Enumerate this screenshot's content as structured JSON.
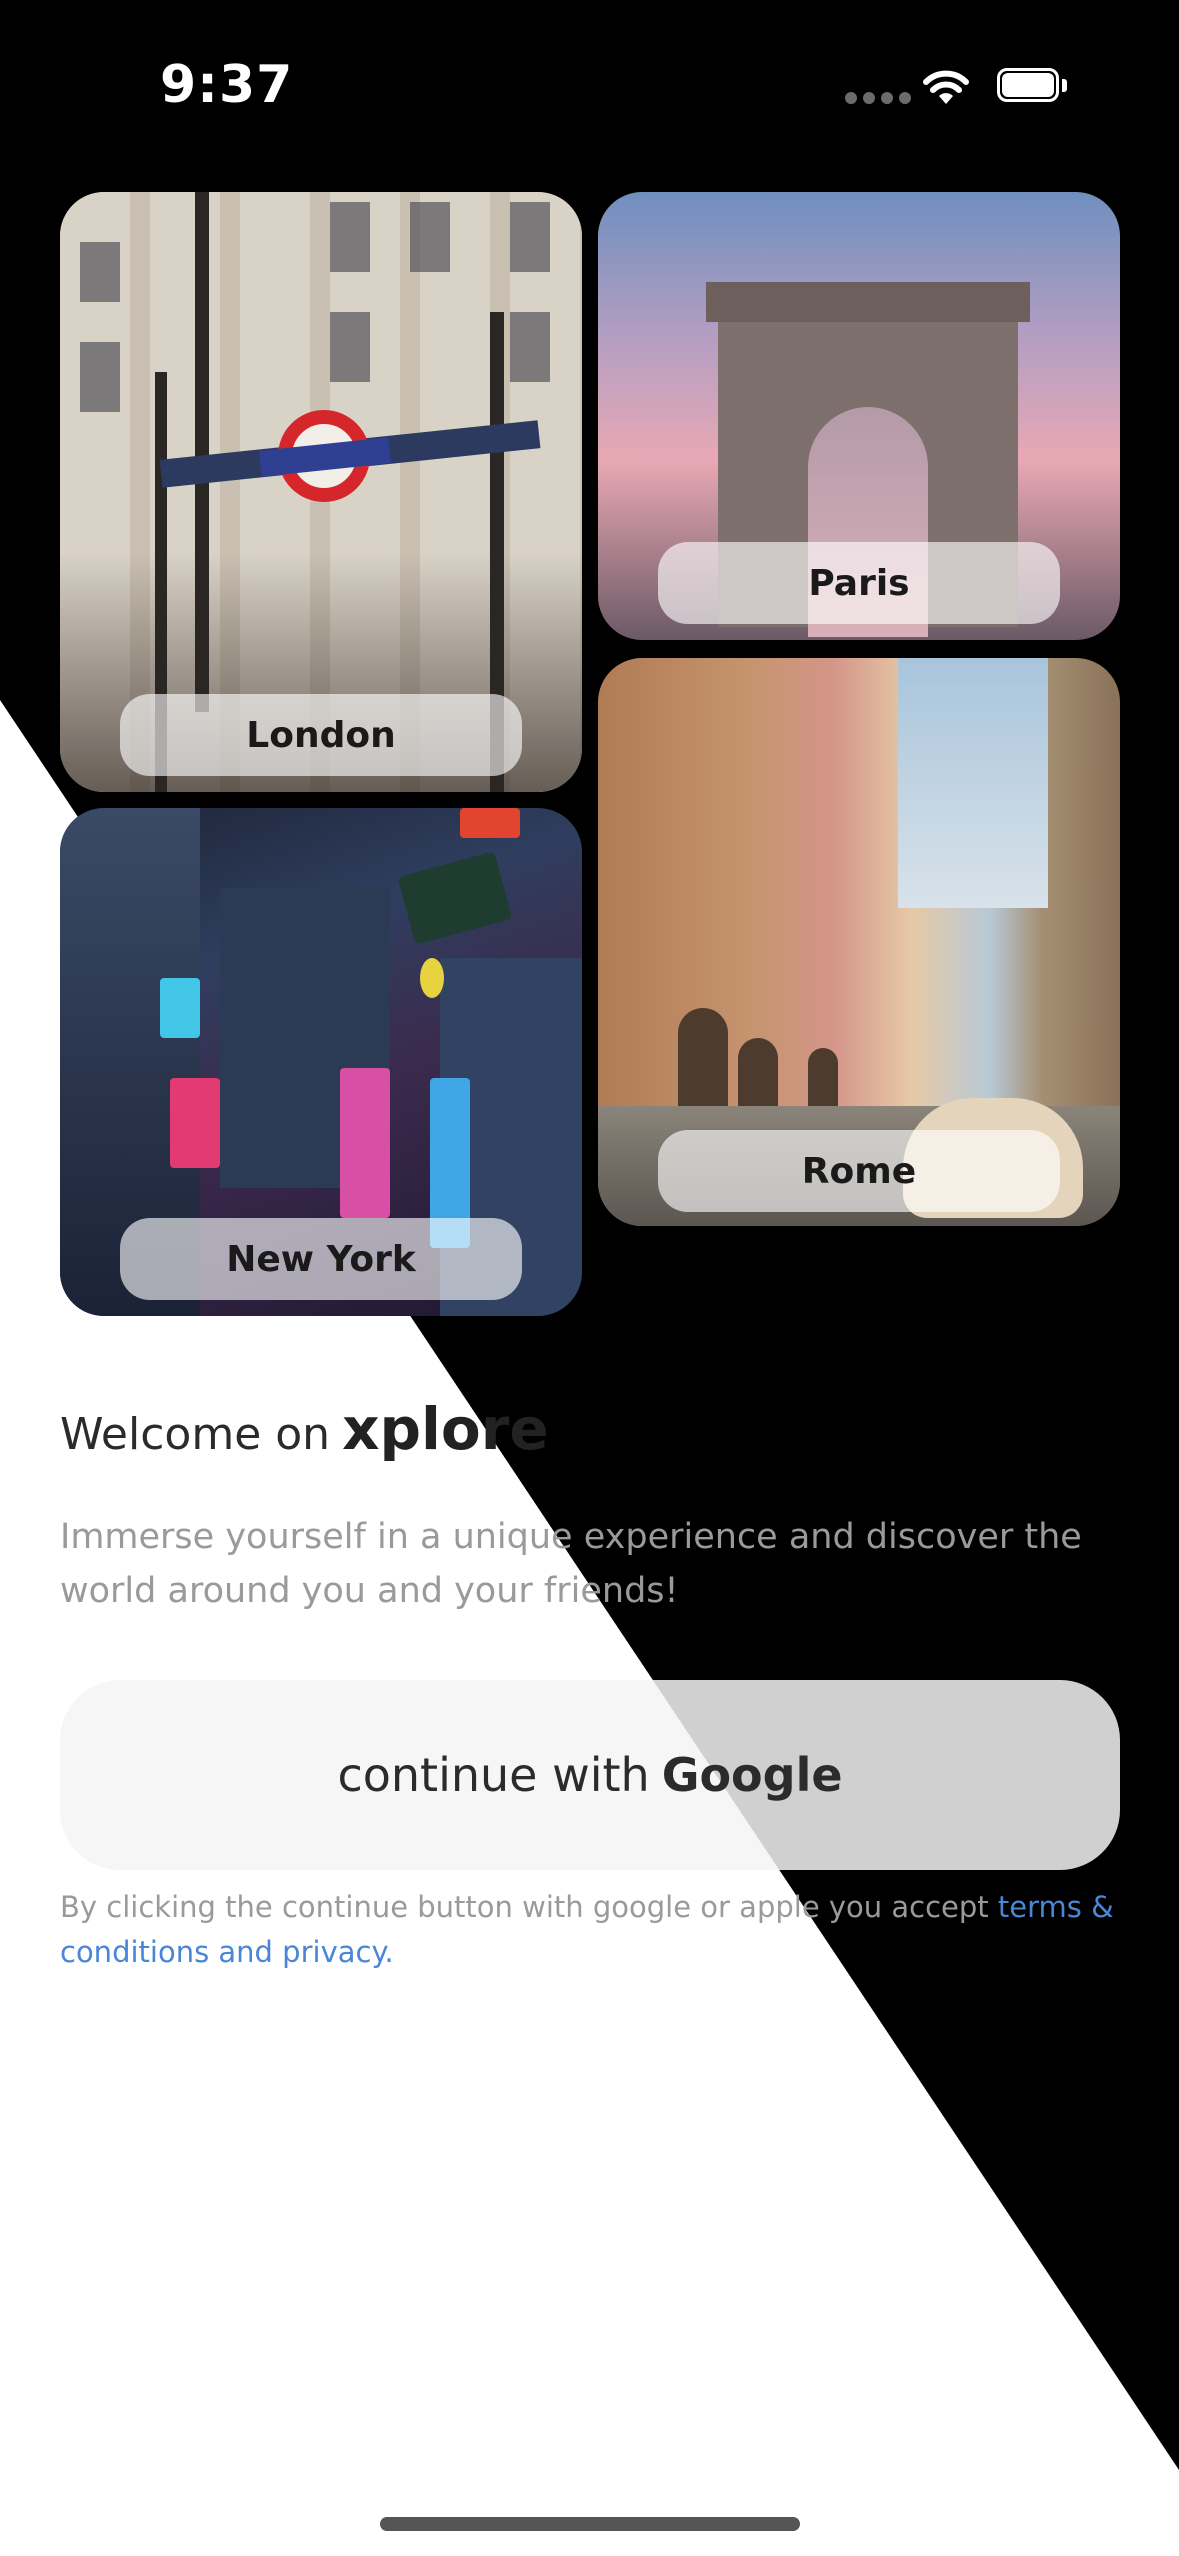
{
  "status_bar": {
    "time": "9:37"
  },
  "destinations": [
    {
      "name": "London"
    },
    {
      "name": "Paris"
    },
    {
      "name": "Rome"
    },
    {
      "name": "New York"
    }
  ],
  "welcome": {
    "prefix": "Welcome on",
    "brand": "xplore"
  },
  "subtitle": "Immerse yourself in a unique experience and discover the world around you and your friends!",
  "google_button": {
    "prefix": "continue with",
    "brand": "Google"
  },
  "legal": {
    "text": "By clicking the continue button with google or apple you accept ",
    "link": "terms & conditions and privacy."
  },
  "colors": {
    "link": "#4a86d6",
    "background_dark": "#000000",
    "background_light": "#ffffff"
  }
}
